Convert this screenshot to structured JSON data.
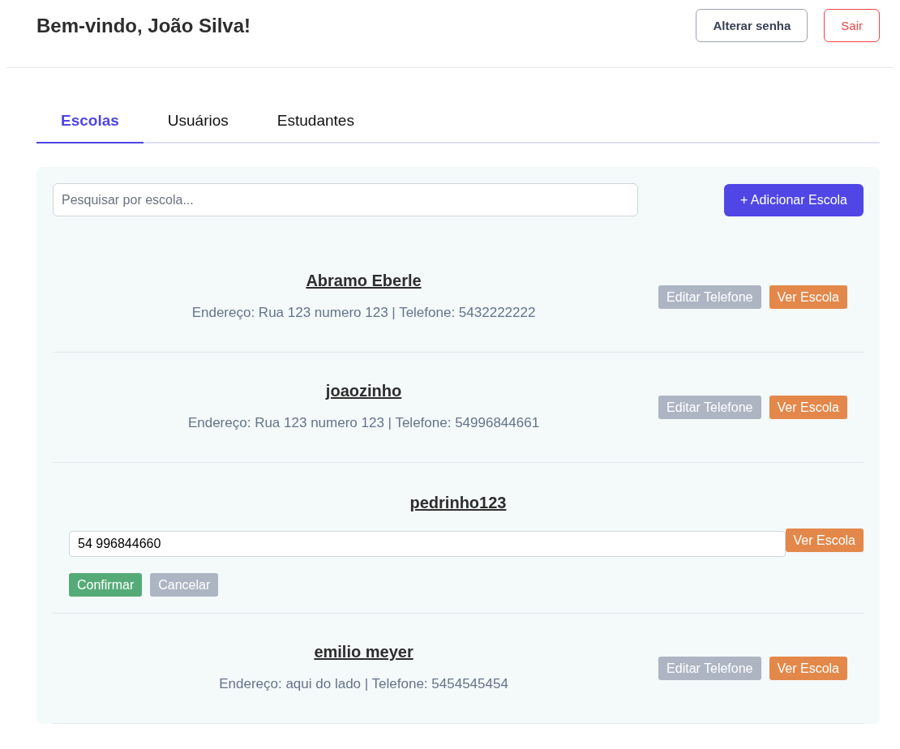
{
  "header": {
    "title": "Bem-vindo, João Silva!",
    "buttons": [
      {
        "kind": "outline",
        "label": "Alterar senha"
      },
      {
        "kind": "danger",
        "label": "Sair"
      }
    ]
  },
  "tabs": [
    {
      "label": "Escolas",
      "selected": true
    },
    {
      "label": "Usuários",
      "selected": false
    },
    {
      "label": "Estudantes",
      "selected": false
    }
  ],
  "search": {
    "placeholder": "Pesquisar por escola..."
  },
  "add_button": "+ Adicionar Escola",
  "schools": [
    {
      "kind": "view",
      "name": "Abramo Eberle",
      "details": "Endereço: Rua 123 numero 123 | Telefone: 5432222222",
      "edit_button": "Editar Telefone",
      "view_button": "Ver Escola"
    },
    {
      "kind": "view",
      "name": "joaozinho",
      "details": "Endereço: Rua 123 numero 123 | Telefone: 54996844661",
      "edit_button": "Editar Telefone",
      "view_button": "Ver Escola"
    },
    {
      "kind": "edit",
      "name": "pedrinho123",
      "phone_value": "54 996844660",
      "confirm_button": "Confirmar",
      "cancel_button": "Cancelar",
      "view_button": "Ver Escola"
    },
    {
      "kind": "view",
      "name": "emilio meyer",
      "details": "Endereço: aqui do lado | Telefone: 5454545454",
      "edit_button": "Editar Telefone",
      "view_button": "Ver Escola"
    }
  ]
}
